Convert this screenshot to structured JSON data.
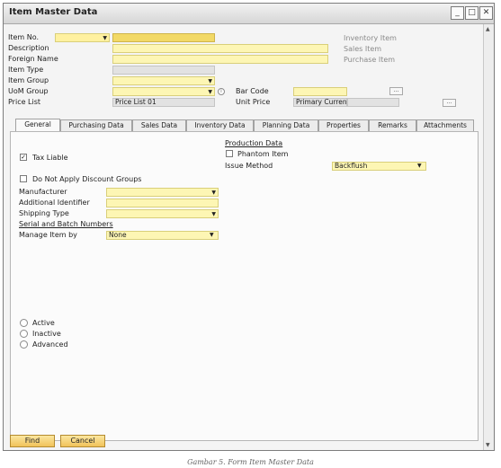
{
  "window": {
    "title": "Item Master Data",
    "minimize": "_",
    "maximize": "□",
    "close": "✕"
  },
  "header": {
    "item_no_label": "Item No.",
    "item_no_value": "",
    "description_label": "Description",
    "foreign_name_label": "Foreign Name",
    "item_type_label": "Item Type",
    "item_group_label": "Item Group",
    "uom_group_label": "UoM Group",
    "price_list_label": "Price List",
    "price_list_value": "Price List 01",
    "bar_code_label": "Bar Code",
    "unit_price_label": "Unit Price",
    "unit_price_currency": "Primary Currenc",
    "inventory_item_label": "Inventory Item",
    "sales_item_label": "Sales Item",
    "purchase_item_label": "Purchase Item",
    "ellipsis": "..."
  },
  "tabs": [
    {
      "label": "General"
    },
    {
      "label": "Purchasing Data"
    },
    {
      "label": "Sales Data"
    },
    {
      "label": "Inventory Data"
    },
    {
      "label": "Planning Data"
    },
    {
      "label": "Properties"
    },
    {
      "label": "Remarks"
    },
    {
      "label": "Attachments"
    }
  ],
  "general": {
    "tax_liable_label": "Tax Liable",
    "tax_liable_checked": true,
    "do_not_apply_label": "Do Not Apply Discount Groups",
    "manufacturer_label": "Manufacturer",
    "additional_identifier_label": "Additional Identifier",
    "shipping_type_label": "Shipping Type",
    "serial_batch_label": "Serial and Batch Numbers",
    "manage_item_by_label": "Manage Item by",
    "manage_item_by_value": "None",
    "production_data_label": "Production Data",
    "phantom_item_label": "Phantom Item",
    "issue_method_label": "Issue Method",
    "issue_method_value": "Backflush",
    "status_options": [
      "Active",
      "Inactive",
      "Advanced"
    ]
  },
  "footer": {
    "find_label": "Find",
    "cancel_label": "Cancel"
  },
  "caption": "Gambar 5. Form Item Master Data",
  "icons": {
    "dropdown": "▼",
    "check": "✓",
    "info": "i"
  }
}
